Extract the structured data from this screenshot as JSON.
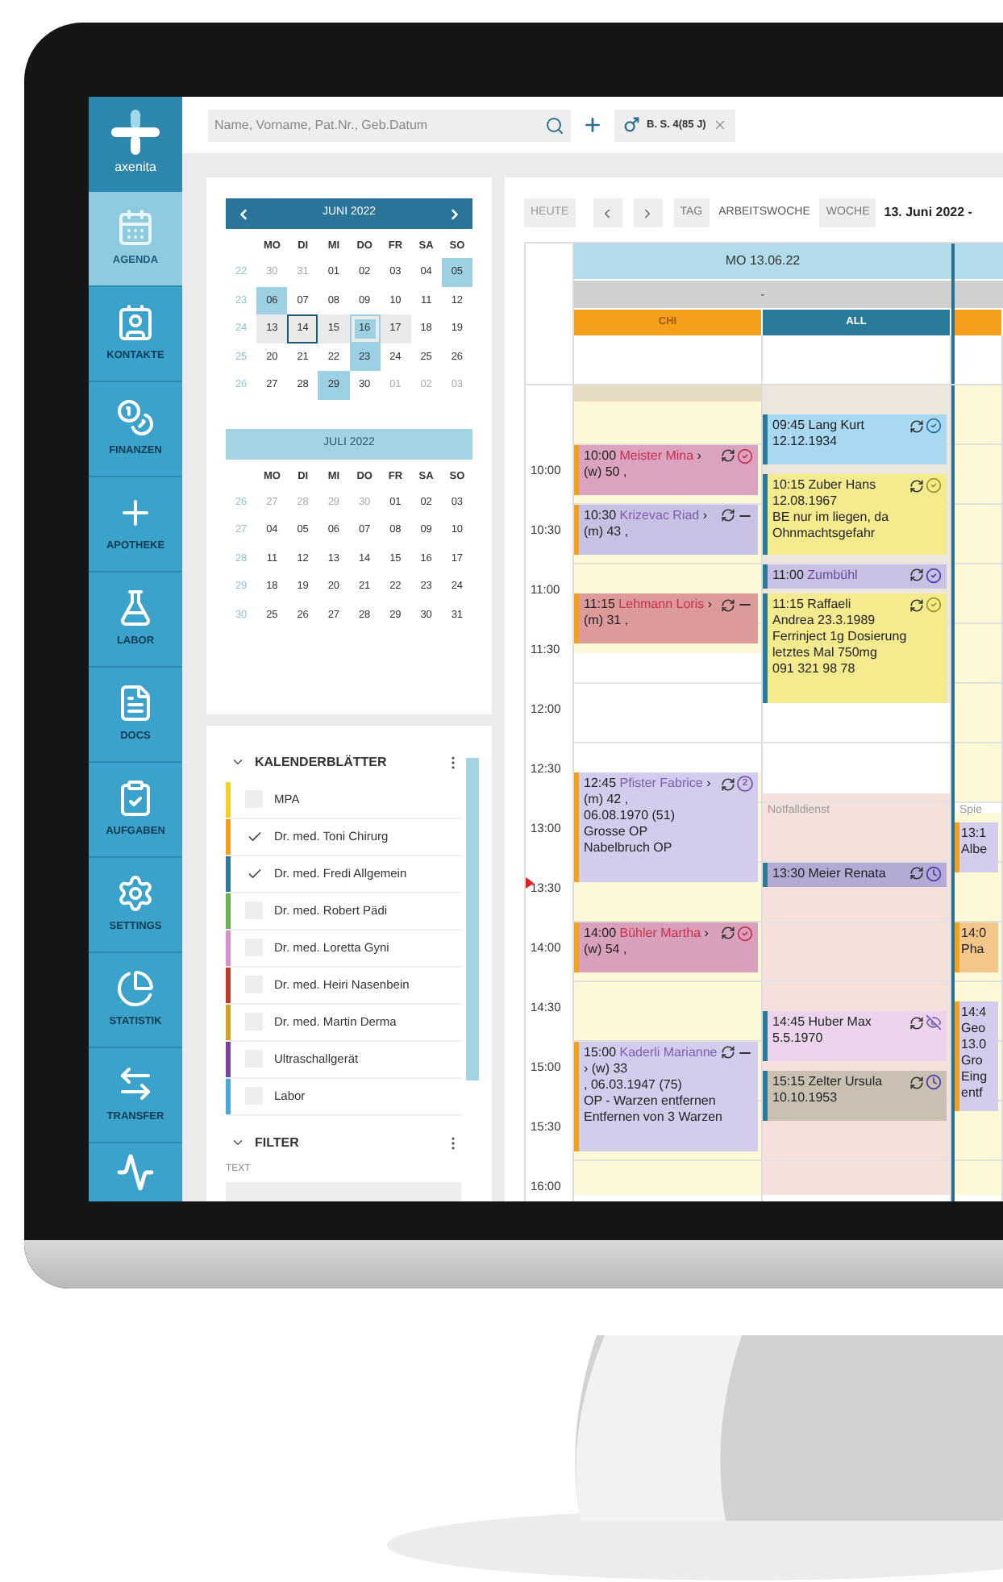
{
  "sidebar": {
    "logo": "axenita",
    "items": [
      {
        "label": "AGENDA",
        "selected": true
      },
      {
        "label": "KONTAKTE",
        "selected": false
      },
      {
        "label": "FINANZEN",
        "selected": false
      },
      {
        "label": "APOTHEKE",
        "selected": false
      },
      {
        "label": "LABOR",
        "selected": false
      },
      {
        "label": "DOCS",
        "selected": false
      },
      {
        "label": "AUFGABEN",
        "selected": false
      },
      {
        "label": "SETTINGS",
        "selected": false
      },
      {
        "label": "STATISTIK",
        "selected": false
      },
      {
        "label": "TRANSFER",
        "selected": false
      }
    ]
  },
  "topbar": {
    "search": {
      "placeholder": "Name, Vorname, Pat.Nr., Geb.Datum"
    },
    "patient_tab": {
      "label": "B. S. 4(85 J)"
    }
  },
  "mini_calendars": [
    {
      "title": "JUNI 2022",
      "kind": "current",
      "weekdays": [
        "MO",
        "DI",
        "MI",
        "DO",
        "FR",
        "SA",
        "SO"
      ],
      "weeks": [
        {
          "number": "22",
          "days": [
            {
              "label": "30",
              "outside": true,
              "marked": false,
              "selected": false,
              "today": false
            },
            {
              "label": "31",
              "outside": true,
              "marked": false,
              "selected": false,
              "today": false
            },
            {
              "label": "01",
              "outside": false,
              "marked": false,
              "selected": false,
              "today": false
            },
            {
              "label": "02",
              "outside": false,
              "marked": false,
              "selected": false,
              "today": false
            },
            {
              "label": "03",
              "outside": false,
              "marked": false,
              "selected": false,
              "today": false
            },
            {
              "label": "04",
              "outside": false,
              "marked": false,
              "selected": false,
              "today": false
            },
            {
              "label": "05",
              "outside": false,
              "marked": true,
              "selected": false,
              "today": false
            }
          ]
        },
        {
          "number": "23",
          "days": [
            {
              "label": "06",
              "outside": false,
              "marked": true,
              "selected": false,
              "today": false
            },
            {
              "label": "07",
              "outside": false,
              "marked": false,
              "selected": false,
              "today": false
            },
            {
              "label": "08",
              "outside": false,
              "marked": false,
              "selected": false,
              "today": false
            },
            {
              "label": "09",
              "outside": false,
              "marked": false,
              "selected": false,
              "today": false
            },
            {
              "label": "10",
              "outside": false,
              "marked": false,
              "selected": false,
              "today": false
            },
            {
              "label": "11",
              "outside": false,
              "marked": false,
              "selected": false,
              "today": false
            },
            {
              "label": "12",
              "outside": false,
              "marked": false,
              "selected": false,
              "today": false
            }
          ]
        },
        {
          "number": "24",
          "days": [
            {
              "label": "13",
              "outside": false,
              "marked": false,
              "selected": true,
              "today": false
            },
            {
              "label": "14",
              "outside": false,
              "marked": false,
              "selected": true,
              "today": true
            },
            {
              "label": "15",
              "outside": false,
              "marked": false,
              "selected": true,
              "today": false
            },
            {
              "label": "16",
              "outside": false,
              "marked": true,
              "selected": true,
              "today": false
            },
            {
              "label": "17",
              "outside": false,
              "marked": false,
              "selected": true,
              "today": false
            },
            {
              "label": "18",
              "outside": false,
              "marked": false,
              "selected": false,
              "today": false
            },
            {
              "label": "19",
              "outside": false,
              "marked": false,
              "selected": false,
              "today": false
            }
          ]
        },
        {
          "number": "25",
          "days": [
            {
              "label": "20",
              "outside": false,
              "marked": false,
              "selected": false,
              "today": false
            },
            {
              "label": "21",
              "outside": false,
              "marked": false,
              "selected": false,
              "today": false
            },
            {
              "label": "22",
              "outside": false,
              "marked": false,
              "selected": false,
              "today": false
            },
            {
              "label": "23",
              "outside": false,
              "marked": true,
              "selected": false,
              "today": false
            },
            {
              "label": "24",
              "outside": false,
              "marked": false,
              "selected": false,
              "today": false
            },
            {
              "label": "25",
              "outside": false,
              "marked": false,
              "selected": false,
              "today": false
            },
            {
              "label": "26",
              "outside": false,
              "marked": false,
              "selected": false,
              "today": false
            }
          ]
        },
        {
          "number": "26",
          "days": [
            {
              "label": "27",
              "outside": false,
              "marked": false,
              "selected": false,
              "today": false
            },
            {
              "label": "28",
              "outside": false,
              "marked": false,
              "selected": false,
              "today": false
            },
            {
              "label": "29",
              "outside": false,
              "marked": true,
              "selected": false,
              "today": false
            },
            {
              "label": "30",
              "outside": false,
              "marked": false,
              "selected": false,
              "today": false
            },
            {
              "label": "01",
              "outside": true,
              "marked": false,
              "selected": false,
              "today": false
            },
            {
              "label": "02",
              "outside": true,
              "marked": false,
              "selected": false,
              "today": false
            },
            {
              "label": "03",
              "outside": true,
              "marked": false,
              "selected": false,
              "today": false
            }
          ]
        }
      ]
    },
    {
      "title": "JULI 2022",
      "kind": "next",
      "weekdays": [
        "MO",
        "DI",
        "MI",
        "DO",
        "FR",
        "SA",
        "SO"
      ],
      "weeks": [
        {
          "number": "26",
          "days": [
            {
              "label": "27",
              "outside": true
            },
            {
              "label": "28",
              "outside": true
            },
            {
              "label": "29",
              "outside": true
            },
            {
              "label": "30",
              "outside": true
            },
            {
              "label": "01",
              "outside": false
            },
            {
              "label": "02",
              "outside": false
            },
            {
              "label": "03",
              "outside": false
            }
          ]
        },
        {
          "number": "27",
          "days": [
            {
              "label": "04",
              "outside": false
            },
            {
              "label": "05",
              "outside": false
            },
            {
              "label": "06",
              "outside": false
            },
            {
              "label": "07",
              "outside": false
            },
            {
              "label": "08",
              "outside": false
            },
            {
              "label": "09",
              "outside": false
            },
            {
              "label": "10",
              "outside": false
            }
          ]
        },
        {
          "number": "28",
          "days": [
            {
              "label": "11",
              "outside": false
            },
            {
              "label": "12",
              "outside": false
            },
            {
              "label": "13",
              "outside": false
            },
            {
              "label": "14",
              "outside": false
            },
            {
              "label": "15",
              "outside": false
            },
            {
              "label": "16",
              "outside": false
            },
            {
              "label": "17",
              "outside": false
            }
          ]
        },
        {
          "number": "29",
          "days": [
            {
              "label": "18",
              "outside": false
            },
            {
              "label": "19",
              "outside": false
            },
            {
              "label": "20",
              "outside": false
            },
            {
              "label": "21",
              "outside": false
            },
            {
              "label": "22",
              "outside": false
            },
            {
              "label": "23",
              "outside": false
            },
            {
              "label": "24",
              "outside": false
            }
          ]
        },
        {
          "number": "30",
          "days": [
            {
              "label": "25",
              "outside": false
            },
            {
              "label": "26",
              "outside": false
            },
            {
              "label": "27",
              "outside": false
            },
            {
              "label": "28",
              "outside": false
            },
            {
              "label": "29",
              "outside": false
            },
            {
              "label": "30",
              "outside": false
            },
            {
              "label": "31",
              "outside": false
            }
          ]
        }
      ]
    }
  ],
  "calendar_sheets": {
    "title": "KALENDERBLÄTTER",
    "items": [
      {
        "label": "MPA",
        "checked": false,
        "color": "#f2d024"
      },
      {
        "label": "Dr. med. Toni Chirurg",
        "checked": true,
        "color": "#f5a01a"
      },
      {
        "label": "Dr. med. Fredi Allgemein",
        "checked": true,
        "color": "#2a7a9a"
      },
      {
        "label": "Dr. med. Robert Pädi",
        "checked": false,
        "color": "#6ab04c"
      },
      {
        "label": "Dr. med. Loretta Gyni",
        "checked": false,
        "color": "#d890c8"
      },
      {
        "label": "Dr. med. Heiri Nasenbein",
        "checked": false,
        "color": "#c0392b"
      },
      {
        "label": "Dr. med. Martin Derma",
        "checked": false,
        "color": "#d4a020"
      },
      {
        "label": "Ultraschallgerät",
        "checked": false,
        "color": "#7b3fa0"
      },
      {
        "label": "Labor",
        "checked": false,
        "color": "#4aa8d8"
      }
    ]
  },
  "filter": {
    "title": "FILTER",
    "field_label": "TEXT"
  },
  "agenda": {
    "today": "HEUTE",
    "views": [
      {
        "label": "TAG",
        "selected": false
      },
      {
        "label": "ARBEITSWOCHE",
        "selected": true
      },
      {
        "label": "WOCHE",
        "selected": false
      }
    ],
    "range": "13. Juni 2022 -",
    "times": [
      "10:00",
      "10:30",
      "11:00",
      "11:30",
      "12:00",
      "12:30",
      "13:00",
      "13:30",
      "14:00",
      "14:30",
      "15:00",
      "15:30",
      "16:00"
    ],
    "days": [
      {
        "label": "MO 13.06.22",
        "subtitle": "-",
        "columns": [
          {
            "label": "CHI",
            "color": "#f5a01a",
            "events": [
              {
                "kind": "half",
                "time": "10:00",
                "patient": {
                  "name": "Meister Mina",
                  "color": "#c8304e"
                },
                "detail": "› (w) 50 ,",
                "color": "#dba3bf",
                "status": {
                  "kind": "check",
                  "color": "#c8304e"
                }
              },
              {
                "kind": "half",
                "time": "10:30",
                "patient": {
                  "name": "Krizevac Riad",
                  "color": "#7a5fb0"
                },
                "detail": "› (m) 43 ,",
                "color": "#c9c1e3",
                "status": {
                  "kind": "dash",
                  "color": "#333333"
                }
              },
              {
                "kind": "half",
                "time": "11:15",
                "patient": {
                  "name": "Lehmann Loris",
                  "color": "#c8304e"
                },
                "detail": "› (m) 31 ,",
                "color": "#dd9a9a",
                "status": {
                  "kind": "dash",
                  "color": "#333333"
                }
              },
              {
                "kind": "hour",
                "time": "12:45",
                "patient": {
                  "name": "Pfister Fabrice",
                  "color": "#7a5fb0"
                },
                "detail": "› (m) 42 ,",
                "lines": [
                  "06.08.1970 (51)",
                  "Grosse OP",
                  "Nabelbruch OP"
                ],
                "color": "#d3ccec",
                "status": {
                  "kind": "count",
                  "badge": "2",
                  "color": "#7a5fb0"
                }
              },
              {
                "kind": "half",
                "time": "14:00",
                "patient": {
                  "name": "Bühler Martha",
                  "color": "#c8304e"
                },
                "detail": "› (w) 54 ,",
                "color": "#d9a0bc",
                "status": {
                  "kind": "check",
                  "color": "#c8304e"
                }
              },
              {
                "kind": "hour",
                "time": "15:00",
                "patient": {
                  "name": "Kaderli Marianne",
                  "color": "#7a5fb0"
                },
                "detail": "› (w) 33",
                "lines": [
                  ", 06.03.1947 (75)",
                  "OP - Warzen entfernen",
                  "Entfernen von 3 Warzen"
                ],
                "color": "#d3ccec",
                "status": {
                  "kind": "dash",
                  "color": "#333333"
                }
              }
            ]
          },
          {
            "label": "ALL",
            "color": "#2a7a9a",
            "banner": "Notfalldienst",
            "events": [
              {
                "kind": "half",
                "time": "09:45",
                "patient": {
                  "name": "Lang Kurt",
                  "color": "#222222"
                },
                "lines": [
                  "12.12.1934"
                ],
                "color": "#a9d9f2",
                "status": {
                  "kind": "check",
                  "color": "#2a6aa8"
                }
              },
              {
                "kind": "long",
                "time": "10:15",
                "patient": {
                  "name": "Zuber Hans",
                  "color": "#222222"
                },
                "lines": [
                  "12.08.1967",
                  "BE nur im liegen, da",
                  "Ohnmachtsgefahr"
                ],
                "color": "#f4ea8e",
                "status": {
                  "kind": "check",
                  "color": "#9a9a20"
                }
              },
              {
                "kind": "short",
                "time": "11:00",
                "patient": {
                  "name": "Zumbühl",
                  "color": "#6a4aa0"
                },
                "color": "#c9c1e3",
                "status": {
                  "kind": "check",
                  "color": "#4a3ab0"
                }
              },
              {
                "kind": "hour",
                "time": "11:15",
                "patient": {
                  "name": "Raffaeli",
                  "color": "#222222"
                },
                "lines": [
                  "Andrea 23.3.1989",
                  "Ferrinject 1g Dosierung",
                  "letztes Mal 750mg",
                  "091 321 98 78"
                ],
                "color": "#f4ea8e",
                "status": {
                  "kind": "check",
                  "color": "#9a9a20"
                }
              },
              {
                "kind": "short",
                "time": "13:30",
                "patient": {
                  "name": "Meier Renata",
                  "color": "#222222"
                },
                "color": "#b4aad6",
                "status": {
                  "kind": "clock",
                  "color": "#4a3ab0"
                }
              },
              {
                "kind": "half",
                "time": "14:45",
                "patient": {
                  "name": "Huber Max",
                  "color": "#222222"
                },
                "lines": [
                  "5.5.1970"
                ],
                "color": "#ecd4ec",
                "status": {
                  "kind": "hidden",
                  "color": "#7a5fb0"
                }
              },
              {
                "kind": "half",
                "time": "15:15",
                "patient": {
                  "name": "Zelter Ursula",
                  "color": "#222222"
                },
                "lines": [
                  "10.10.1953"
                ],
                "color": "#c9c0b2",
                "status": {
                  "kind": "clock",
                  "color": "#4a3ab0"
                }
              }
            ]
          }
        ]
      },
      {
        "columns": [
          {
            "color": "#f5a01a",
            "banner": "Spie",
            "events": [
              {
                "kind": "half",
                "time": "13:1",
                "lines": [
                  "Albe"
                ],
                "color": "#d3ccec"
              },
              {
                "kind": "half",
                "time": "14:0",
                "lines": [
                  "Pha"
                ],
                "color": "#f3c78a"
              },
              {
                "kind": "hour",
                "time": "14:4",
                "lines": [
                  "Geo",
                  "13.0",
                  "Gro",
                  "Eing",
                  "entf"
                ],
                "color": "#d3ccec"
              }
            ]
          }
        ]
      }
    ]
  }
}
